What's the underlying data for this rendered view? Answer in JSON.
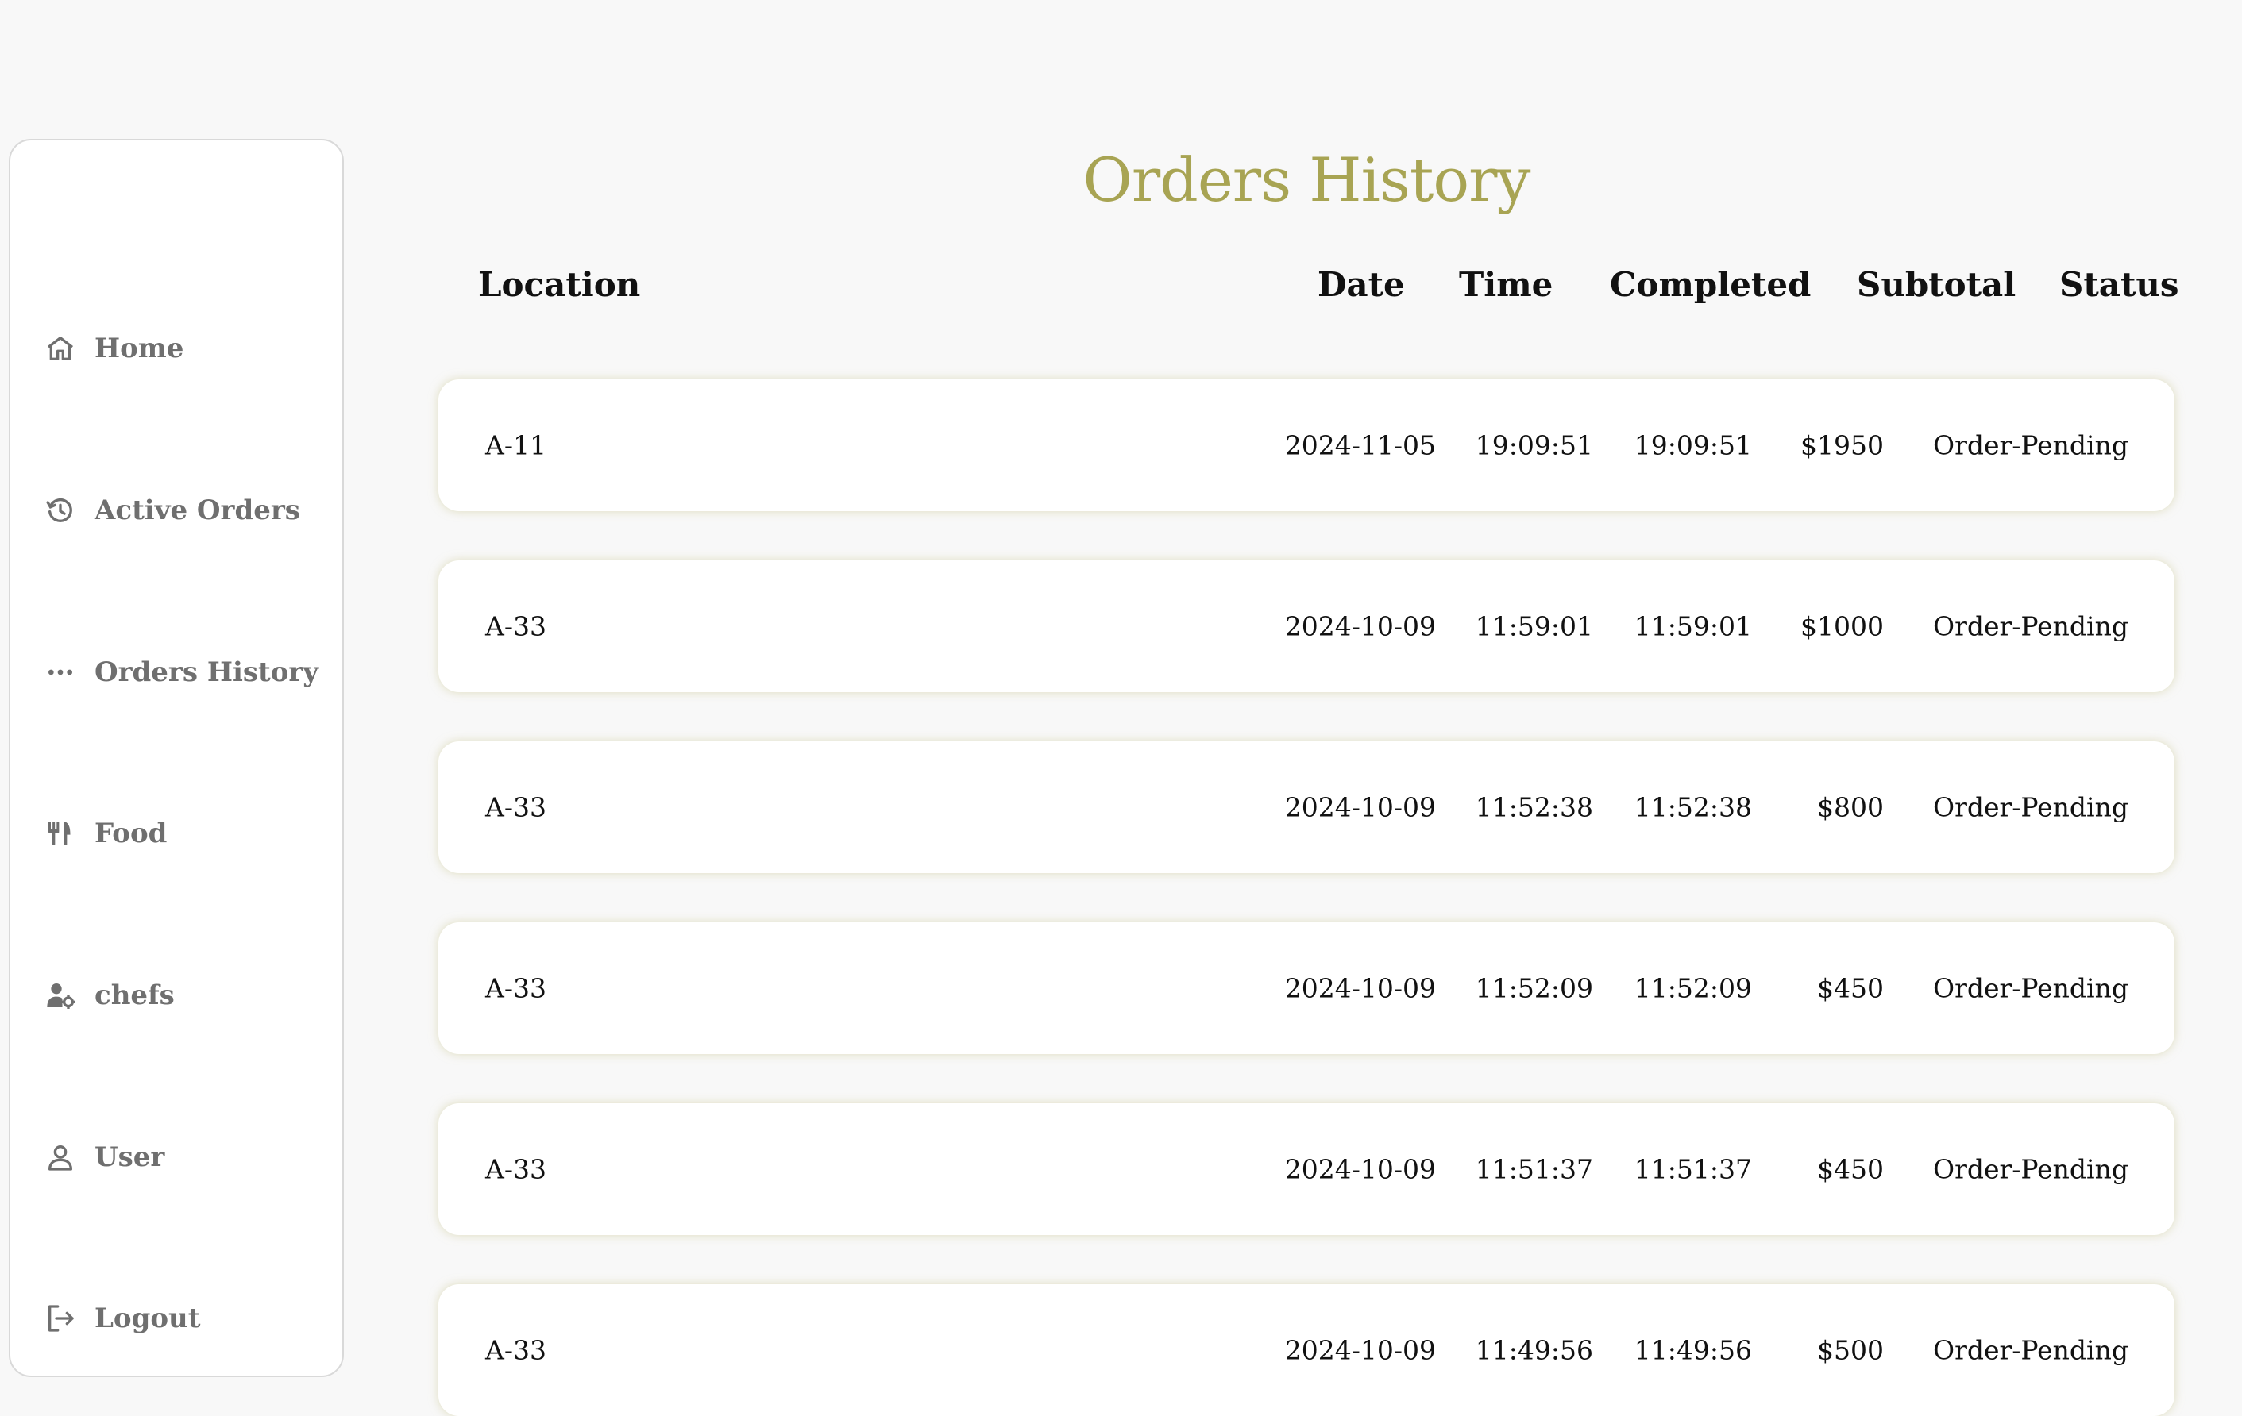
{
  "sidebar": {
    "items": [
      {
        "label": "Home",
        "icon": "home-icon"
      },
      {
        "label": "Active Orders",
        "icon": "history-icon"
      },
      {
        "label": "Orders History",
        "icon": "more-dots-icon"
      },
      {
        "label": "Food",
        "icon": "utensils-icon"
      },
      {
        "label": "chefs",
        "icon": "user-gear-icon"
      },
      {
        "label": "User",
        "icon": "user-icon"
      },
      {
        "label": "Logout",
        "icon": "logout-icon"
      }
    ]
  },
  "main": {
    "title": "Orders History",
    "columns": {
      "location": "Location",
      "date": "Date",
      "time": "Time",
      "completed": "Completed",
      "subtotal": "Subtotal",
      "status": "Status"
    },
    "rows": [
      {
        "location": "A-11",
        "date": "2024-11-05",
        "time": "19:09:51",
        "completed": "19:09:51",
        "subtotal": "$1950",
        "status": "Order-Pending"
      },
      {
        "location": "A-33",
        "date": "2024-10-09",
        "time": "11:59:01",
        "completed": "11:59:01",
        "subtotal": "$1000",
        "status": "Order-Pending"
      },
      {
        "location": "A-33",
        "date": "2024-10-09",
        "time": "11:52:38",
        "completed": "11:52:38",
        "subtotal": "$800",
        "status": "Order-Pending"
      },
      {
        "location": "A-33",
        "date": "2024-10-09",
        "time": "11:52:09",
        "completed": "11:52:09",
        "subtotal": "$450",
        "status": "Order-Pending"
      },
      {
        "location": "A-33",
        "date": "2024-10-09",
        "time": "11:51:37",
        "completed": "11:51:37",
        "subtotal": "$450",
        "status": "Order-Pending"
      },
      {
        "location": "A-33",
        "date": "2024-10-09",
        "time": "11:49:56",
        "completed": "11:49:56",
        "subtotal": "$500",
        "status": "Order-Pending"
      }
    ]
  },
  "colors": {
    "accent": "#a8a453",
    "nav_text": "#6f6f6f",
    "background": "#f8f8f8"
  }
}
